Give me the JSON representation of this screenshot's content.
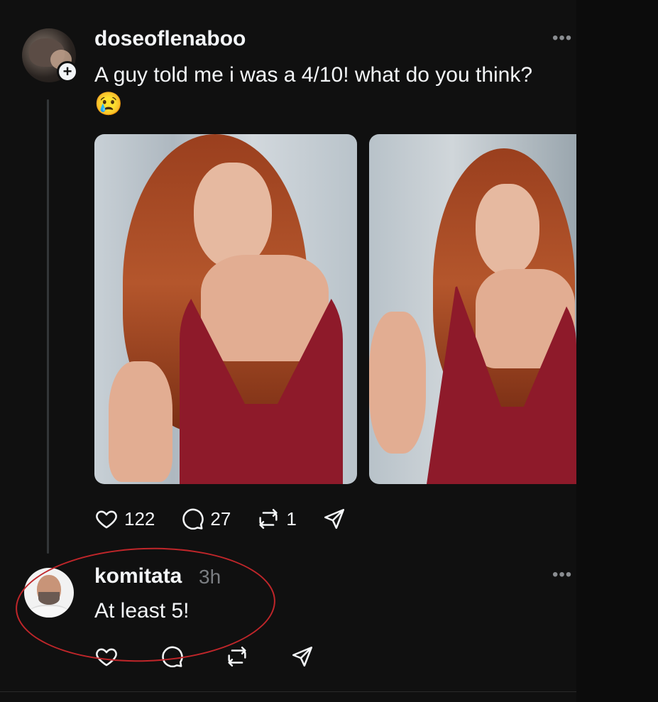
{
  "post": {
    "username": "doseoflenaboo",
    "text": "A guy told me i was a 4/10! what do you think?",
    "emoji": "😢",
    "more_label": "•••",
    "follow_label": "+",
    "images": [
      {
        "alt": "photo-1"
      },
      {
        "alt": "photo-2"
      }
    ],
    "actions": {
      "likes": "122",
      "comments": "27",
      "reposts": "1"
    }
  },
  "reply": {
    "username": "komitata",
    "time": "3h",
    "text": "At least 5!",
    "more_label": "•••"
  },
  "colors": {
    "background": "#101010",
    "text": "#f3f5f7",
    "muted": "#7a7d81",
    "annotation": "#c0262a"
  },
  "icons": [
    "heart-icon",
    "comment-icon",
    "repost-icon",
    "share-icon",
    "more-icon",
    "plus-icon"
  ]
}
